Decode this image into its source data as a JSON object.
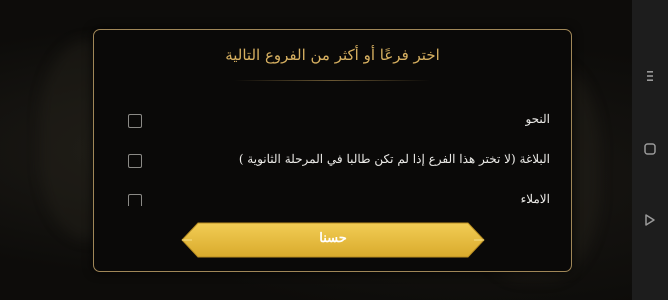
{
  "dialog": {
    "title": "اختر فرعًا أو أكثر من الفروع التالية",
    "branches": [
      {
        "label": "النحو",
        "checked": false
      },
      {
        "label": "البلاغة (لا تختر هذا الفرع إذا لم تكن طالبا في المرحلة الثانوية )",
        "checked": false
      },
      {
        "label": "الاملاء",
        "checked": false
      }
    ],
    "ok_button": "حسنا"
  },
  "nav_bar": {
    "icons": [
      "menu-icon",
      "home-icon",
      "back-icon"
    ]
  },
  "colors": {
    "accent_gold": "#e8bf3e",
    "title_gold": "#d7b061",
    "border_gold": "#a08758"
  }
}
